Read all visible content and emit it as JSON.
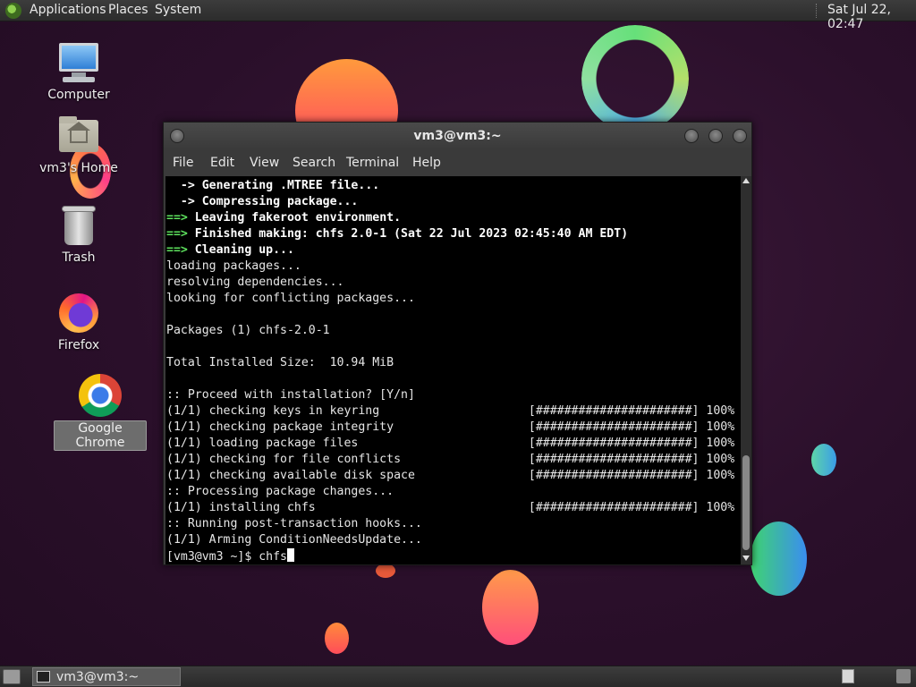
{
  "top_panel": {
    "menu": [
      "Applications",
      "Places",
      "System"
    ],
    "clock": "Sat Jul 22, 02:47"
  },
  "desktop_icons": [
    {
      "label": "Computer",
      "icon": "computer-icon"
    },
    {
      "label": "vm3's Home",
      "icon": "home-folder-icon"
    },
    {
      "label": "Trash",
      "icon": "trash-icon"
    },
    {
      "label": "Firefox",
      "icon": "firefox-icon"
    },
    {
      "label": "Google Chrome",
      "icon": "chrome-icon"
    }
  ],
  "terminal": {
    "title": "vm3@vm3:~",
    "menu": [
      "File",
      "Edit",
      "View",
      "Search",
      "Terminal",
      "Help"
    ],
    "lines": [
      {
        "prefix": "  -> ",
        "text": "Generating .MTREE file...",
        "style": "bold-arrow"
      },
      {
        "prefix": "  -> ",
        "text": "Compressing package...",
        "style": "bold-arrow"
      },
      {
        "prefix": "==> ",
        "text": "Leaving fakeroot environment.",
        "style": "green-arrow"
      },
      {
        "prefix": "==> ",
        "text": "Finished making: chfs 2.0-1 (Sat 22 Jul 2023 02:45:40 AM EDT)",
        "style": "green-arrow"
      },
      {
        "prefix": "==> ",
        "text": "Cleaning up...",
        "style": "green-arrow"
      },
      {
        "prefix": "",
        "text": "loading packages...",
        "style": "plain"
      },
      {
        "prefix": "",
        "text": "resolving dependencies...",
        "style": "plain"
      },
      {
        "prefix": "",
        "text": "looking for conflicting packages...",
        "style": "plain"
      },
      {
        "prefix": "",
        "text": "",
        "style": "plain"
      },
      {
        "prefix": "",
        "text": "Packages (1) chfs-2.0-1",
        "style": "plain"
      },
      {
        "prefix": "",
        "text": "",
        "style": "plain"
      },
      {
        "prefix": "",
        "text": "Total Installed Size:  10.94 MiB",
        "style": "plain"
      },
      {
        "prefix": "",
        "text": "",
        "style": "plain"
      },
      {
        "prefix": "",
        "text": ":: Proceed with installation? [Y/n]",
        "style": "plain"
      },
      {
        "prefix": "",
        "text": "(1/1) checking keys in keyring                     [######################] 100%",
        "style": "plain"
      },
      {
        "prefix": "",
        "text": "(1/1) checking package integrity                   [######################] 100%",
        "style": "plain"
      },
      {
        "prefix": "",
        "text": "(1/1) loading package files                        [######################] 100%",
        "style": "plain"
      },
      {
        "prefix": "",
        "text": "(1/1) checking for file conflicts                  [######################] 100%",
        "style": "plain"
      },
      {
        "prefix": "",
        "text": "(1/1) checking available disk space                [######################] 100%",
        "style": "plain"
      },
      {
        "prefix": "",
        "text": ":: Processing package changes...",
        "style": "plain"
      },
      {
        "prefix": "",
        "text": "(1/1) installing chfs                              [######################] 100%",
        "style": "plain"
      },
      {
        "prefix": "",
        "text": ":: Running post-transaction hooks...",
        "style": "plain"
      },
      {
        "prefix": "",
        "text": "(1/1) Arming ConditionNeedsUpdate...",
        "style": "plain"
      }
    ],
    "prompt": "[vm3@vm3 ~]$ ",
    "input": "chfs"
  },
  "bottom_panel": {
    "task_label": "vm3@vm3:~"
  }
}
